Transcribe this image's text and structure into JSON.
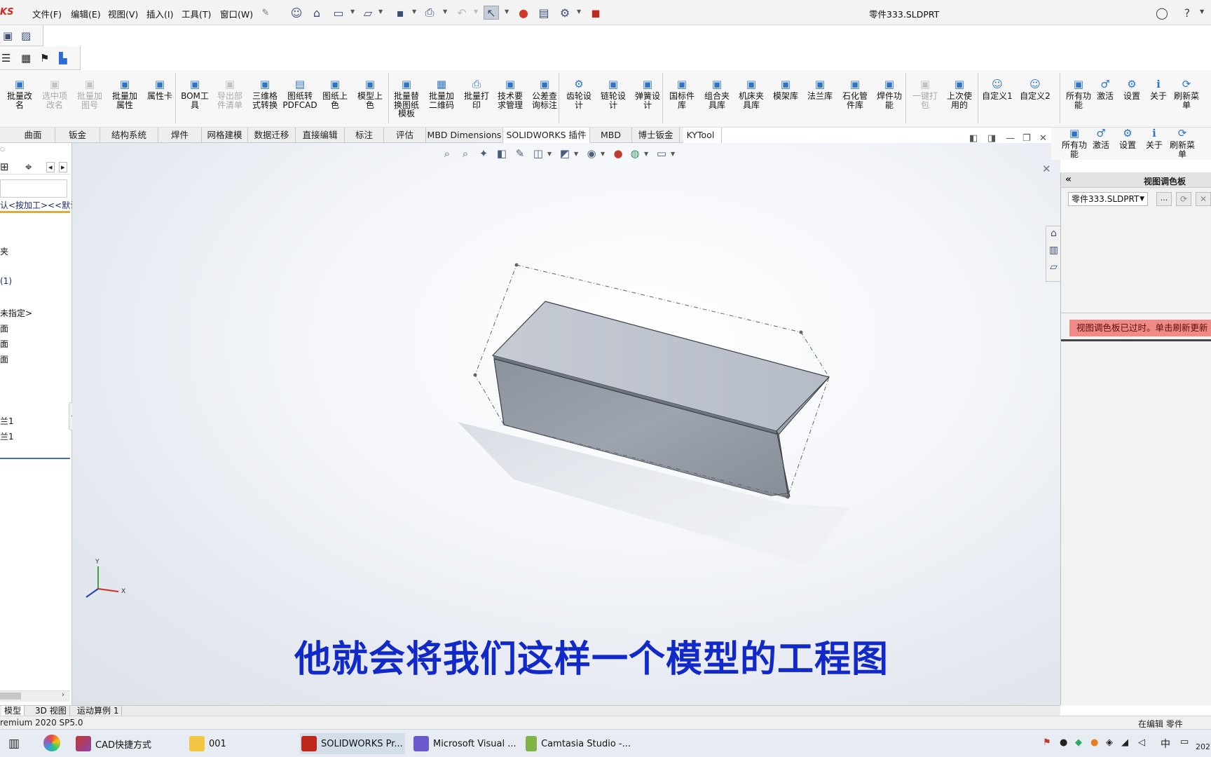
{
  "app": {
    "logo_text": "KS",
    "document_title": "零件333.SLDPRT"
  },
  "menu": {
    "items": [
      "文件(F)",
      "编辑(E)",
      "视图(V)",
      "插入(I)",
      "工具(T)",
      "窗口(W)"
    ]
  },
  "toolbar": {
    "buttons": [
      {
        "label": "批量改\n名",
        "icon": "rename-icon",
        "enabled": true
      },
      {
        "label": "选中项\n改名",
        "icon": "rename-selected-icon",
        "enabled": false
      },
      {
        "label": "批量加\n图号",
        "icon": "add-drawing-number-icon",
        "enabled": false
      },
      {
        "label": "批量加\n属性",
        "icon": "add-properties-icon",
        "enabled": true
      },
      {
        "label": "属性卡",
        "icon": "property-card-icon",
        "enabled": true
      },
      {
        "label": "BOM工\n具",
        "icon": "bom-icon",
        "enabled": true
      },
      {
        "label": "导出部\n件清单",
        "icon": "export-list-icon",
        "enabled": false
      },
      {
        "label": "三维格\n式转换",
        "icon": "3d-convert-icon",
        "enabled": true
      },
      {
        "label": "图纸转\nPDFCAD",
        "icon": "pdf-icon",
        "enabled": true
      },
      {
        "label": "图纸上\n色",
        "icon": "drawing-color-icon",
        "enabled": true
      },
      {
        "label": "模型上\n色",
        "icon": "model-color-icon",
        "enabled": true
      },
      {
        "label": "批量替\n换图纸\n模板",
        "icon": "replace-template-icon",
        "enabled": true
      },
      {
        "label": "批量加\n二维码",
        "icon": "qrcode-icon",
        "enabled": true
      },
      {
        "label": "批量打\n印",
        "icon": "print-icon",
        "enabled": true
      },
      {
        "label": "技术要\n求管理",
        "icon": "requirements-icon",
        "enabled": true
      },
      {
        "label": "公差查\n询标注",
        "icon": "tolerance-icon",
        "enabled": true
      },
      {
        "label": "齿轮设\n计",
        "icon": "gear-design-icon",
        "enabled": true
      },
      {
        "label": "链轮设\n计",
        "icon": "sprocket-icon",
        "enabled": true
      },
      {
        "label": "弹簧设\n计",
        "icon": "spring-icon",
        "enabled": true
      },
      {
        "label": "国标件\n库",
        "icon": "standard-parts-icon",
        "enabled": true
      },
      {
        "label": "组合夹\n具库",
        "icon": "fixture-library-icon",
        "enabled": true
      },
      {
        "label": "机床夹\n具库",
        "icon": "machine-fixture-icon",
        "enabled": true
      },
      {
        "label": "模架库",
        "icon": "mold-base-icon",
        "enabled": true
      },
      {
        "label": "法兰库",
        "icon": "flange-icon",
        "enabled": true
      },
      {
        "label": "石化管\n件库",
        "icon": "pipe-fittings-icon",
        "enabled": true
      },
      {
        "label": "焊件功\n能",
        "icon": "weldment-icon",
        "enabled": true
      },
      {
        "label": "一键打\n包",
        "icon": "pack-icon",
        "enabled": false
      },
      {
        "label": "上次使\n用的",
        "icon": "last-used-icon",
        "enabled": true
      },
      {
        "label": "自定义1",
        "icon": "user-icon",
        "enabled": true
      },
      {
        "label": "自定义2",
        "icon": "user-icon",
        "enabled": true
      },
      {
        "label": "所有功\n能",
        "icon": "all-functions-icon",
        "enabled": true
      },
      {
        "label": "激活",
        "icon": "activate-icon",
        "enabled": true
      },
      {
        "label": "设置",
        "icon": "settings-icon",
        "enabled": true
      },
      {
        "label": "关于",
        "icon": "info-icon",
        "enabled": true
      },
      {
        "label": "刷新菜\n单",
        "icon": "refresh-icon",
        "enabled": true
      }
    ],
    "right_dup": [
      "所有功\n能",
      "激活",
      "设置",
      "关于",
      "刷新菜\n单"
    ]
  },
  "tabs": [
    "曲面",
    "钣金",
    "结构系统",
    "焊件",
    "网格建模",
    "数据迁移",
    "直接编辑",
    "标注",
    "评估",
    "MBD Dimensions",
    "SOLIDWORKS 插件",
    "MBD",
    "博士钣金",
    "KYTool"
  ],
  "active_tab": "SOLIDWORKS 插件",
  "feature_tree": {
    "items": [
      "认<按加工><<默认",
      "",
      "夹",
      "(1)",
      "未指定>",
      "面",
      "面",
      "面",
      "兰1",
      "兰1",
      ""
    ]
  },
  "task_pane": {
    "title": "视图调色板",
    "collapse_label": "«",
    "selected_file": "零件333.SLDPRT",
    "browse_label": "...",
    "warning": "视图调色板已过时。单击刷新更新"
  },
  "bottom_tabs": [
    "模型",
    "3D 视图",
    "运动算例 1"
  ],
  "status": {
    "version": "remium 2020 SP5.0",
    "mode": "在编辑 零件"
  },
  "taskbar": {
    "apps": [
      "CAD快捷方式",
      "001",
      "SOLIDWORKS Pr...",
      "Microsoft Visual ...",
      "Camtasia Studio -..."
    ],
    "ime": "中",
    "clock": "202"
  },
  "subtitle": "他就会将我们这样一个模型的工程图",
  "triad": {
    "y": "Y",
    "x": "X"
  },
  "colors": {
    "accent": "#1229c9",
    "warning_bg": "#f08a87",
    "brand": "#d9261c"
  }
}
